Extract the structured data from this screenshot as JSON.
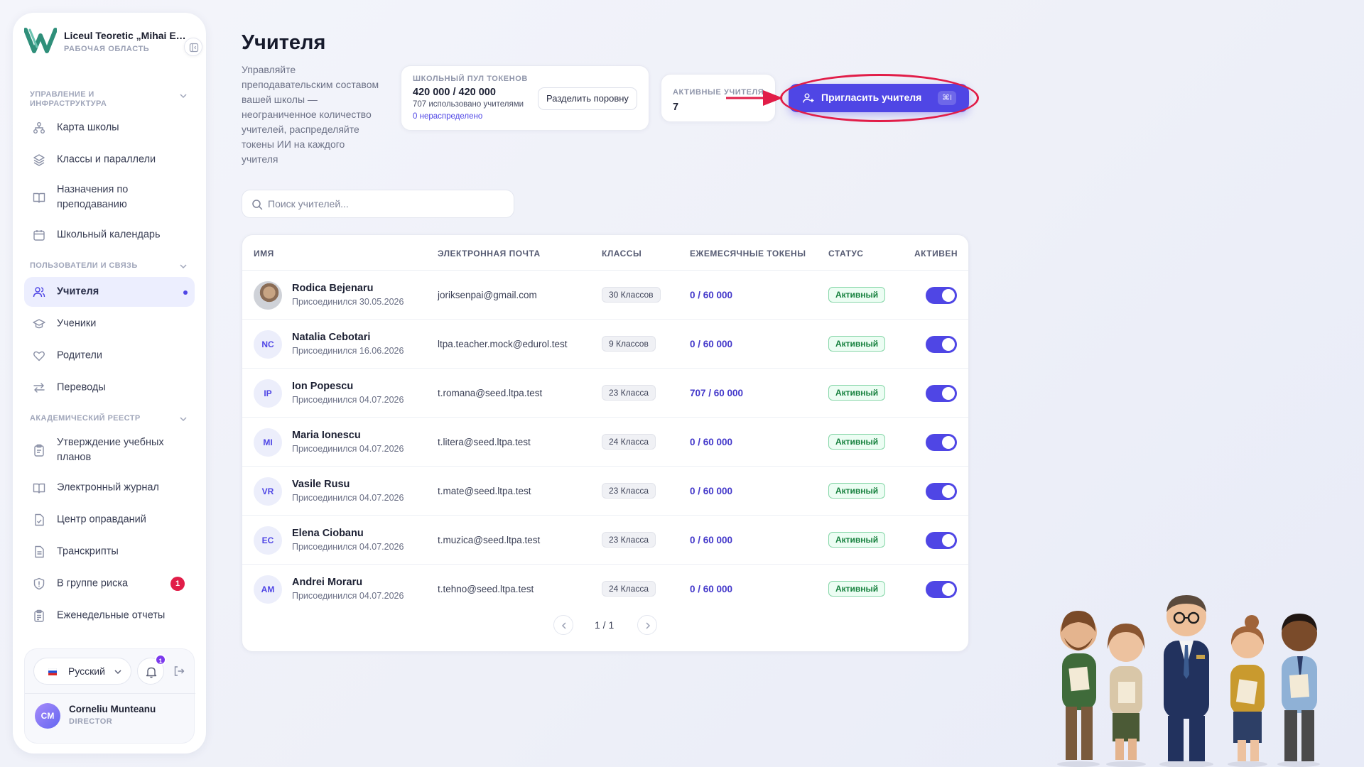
{
  "sidebar": {
    "school_name": "Liceul Teoretic „Mihai Eminescu”",
    "workspace_label": "РАБОЧАЯ ОБЛАСТЬ",
    "sections": [
      {
        "title": "Управление и инфраструктура",
        "items": [
          {
            "label": "Карта школы",
            "icon": "hierarchy-icon"
          },
          {
            "label": "Классы и параллели",
            "icon": "layers-icon"
          },
          {
            "label": "Назначения по преподаванию",
            "icon": "book-open-icon"
          },
          {
            "label": "Школьный календарь",
            "icon": "calendar-icon"
          }
        ]
      },
      {
        "title": "Пользователи и связь",
        "items": [
          {
            "label": "Учителя",
            "icon": "users-icon",
            "active": true
          },
          {
            "label": "Ученики",
            "icon": "graduation-cap-icon"
          },
          {
            "label": "Родители",
            "icon": "heart-icon"
          },
          {
            "label": "Переводы",
            "icon": "arrows-swap-icon"
          }
        ]
      },
      {
        "title": "Академический реестр",
        "items": [
          {
            "label": "Утверждение учебных планов",
            "icon": "clipboard-icon"
          },
          {
            "label": "Электронный журнал",
            "icon": "book-open-icon"
          },
          {
            "label": "Центр оправданий",
            "icon": "file-check-icon"
          },
          {
            "label": "Транскрипты",
            "icon": "file-text-icon"
          },
          {
            "label": "В группе риска",
            "icon": "shield-icon",
            "badge": "1"
          },
          {
            "label": "Еженедельные отчеты",
            "icon": "clipboard-list-icon"
          }
        ]
      }
    ],
    "footer": {
      "language": "Русский",
      "notifications_count": "1",
      "user_initials": "CM",
      "user_name": "Corneliu Munteanu",
      "user_role": "DIRECTOR"
    }
  },
  "header": {
    "title": "Учителя",
    "description": "Управляйте преподавательским составом вашей школы — неограниченное количество учителей, распределяйте токены ИИ на каждого учителя"
  },
  "token_pool": {
    "label": "ШКОЛЬНЫЙ ПУЛ ТОКЕНОВ",
    "value": "420 000 / 420 000",
    "used_text": "707 использовано учителями",
    "unallocated_text": "0 нераспределено",
    "split_button": "Разделить поровну"
  },
  "active_teachers": {
    "label": "АКТИВНЫЕ УЧИТЕЛЯ",
    "value": "7"
  },
  "invite_button": {
    "label": "Пригласить учителя",
    "shortcut": "⌘I"
  },
  "search": {
    "placeholder": "Поиск учителей..."
  },
  "table": {
    "columns": [
      "ИМЯ",
      "ЭЛЕКТРОННАЯ ПОЧТА",
      "КЛАССЫ",
      "ЕЖЕМЕСЯЧНЫЕ ТОКЕНЫ",
      "СТАТУС",
      "АКТИВЕН"
    ],
    "rows": [
      {
        "initials": "",
        "photo": true,
        "name": "Rodica Bejenaru",
        "joined": "Присоединился 30.05.2026",
        "email": "joriksenpai@gmail.com",
        "classes": "30 Классов",
        "tokens": "0 / 60 000",
        "status": "Активный",
        "active": true
      },
      {
        "initials": "NC",
        "name": "Natalia Cebotari",
        "joined": "Присоединился 16.06.2026",
        "email": "ltpa.teacher.mock@edurol.test",
        "classes": "9 Классов",
        "tokens": "0 / 60 000",
        "status": "Активный",
        "active": true
      },
      {
        "initials": "IP",
        "name": "Ion Popescu",
        "joined": "Присоединился 04.07.2026",
        "email": "t.romana@seed.ltpa.test",
        "classes": "23 Класса",
        "tokens": "707 / 60 000",
        "status": "Активный",
        "active": true
      },
      {
        "initials": "MI",
        "name": "Maria Ionescu",
        "joined": "Присоединился 04.07.2026",
        "email": "t.litera@seed.ltpa.test",
        "classes": "24 Класса",
        "tokens": "0 / 60 000",
        "status": "Активный",
        "active": true
      },
      {
        "initials": "VR",
        "name": "Vasile Rusu",
        "joined": "Присоединился 04.07.2026",
        "email": "t.mate@seed.ltpa.test",
        "classes": "23 Класса",
        "tokens": "0 / 60 000",
        "status": "Активный",
        "active": true
      },
      {
        "initials": "EC",
        "name": "Elena Ciobanu",
        "joined": "Присоединился 04.07.2026",
        "email": "t.muzica@seed.ltpa.test",
        "classes": "23 Класса",
        "tokens": "0 / 60 000",
        "status": "Активный",
        "active": true
      },
      {
        "initials": "AM",
        "name": "Andrei Moraru",
        "joined": "Присоединился 04.07.2026",
        "email": "t.tehno@seed.ltpa.test",
        "classes": "24 Класса",
        "tokens": "0 / 60 000",
        "status": "Активный",
        "active": true
      }
    ],
    "pagination": "1 / 1"
  },
  "colors": {
    "accent": "#4f46e5",
    "highlight": "#e11d48",
    "status_green": "#15803d"
  }
}
